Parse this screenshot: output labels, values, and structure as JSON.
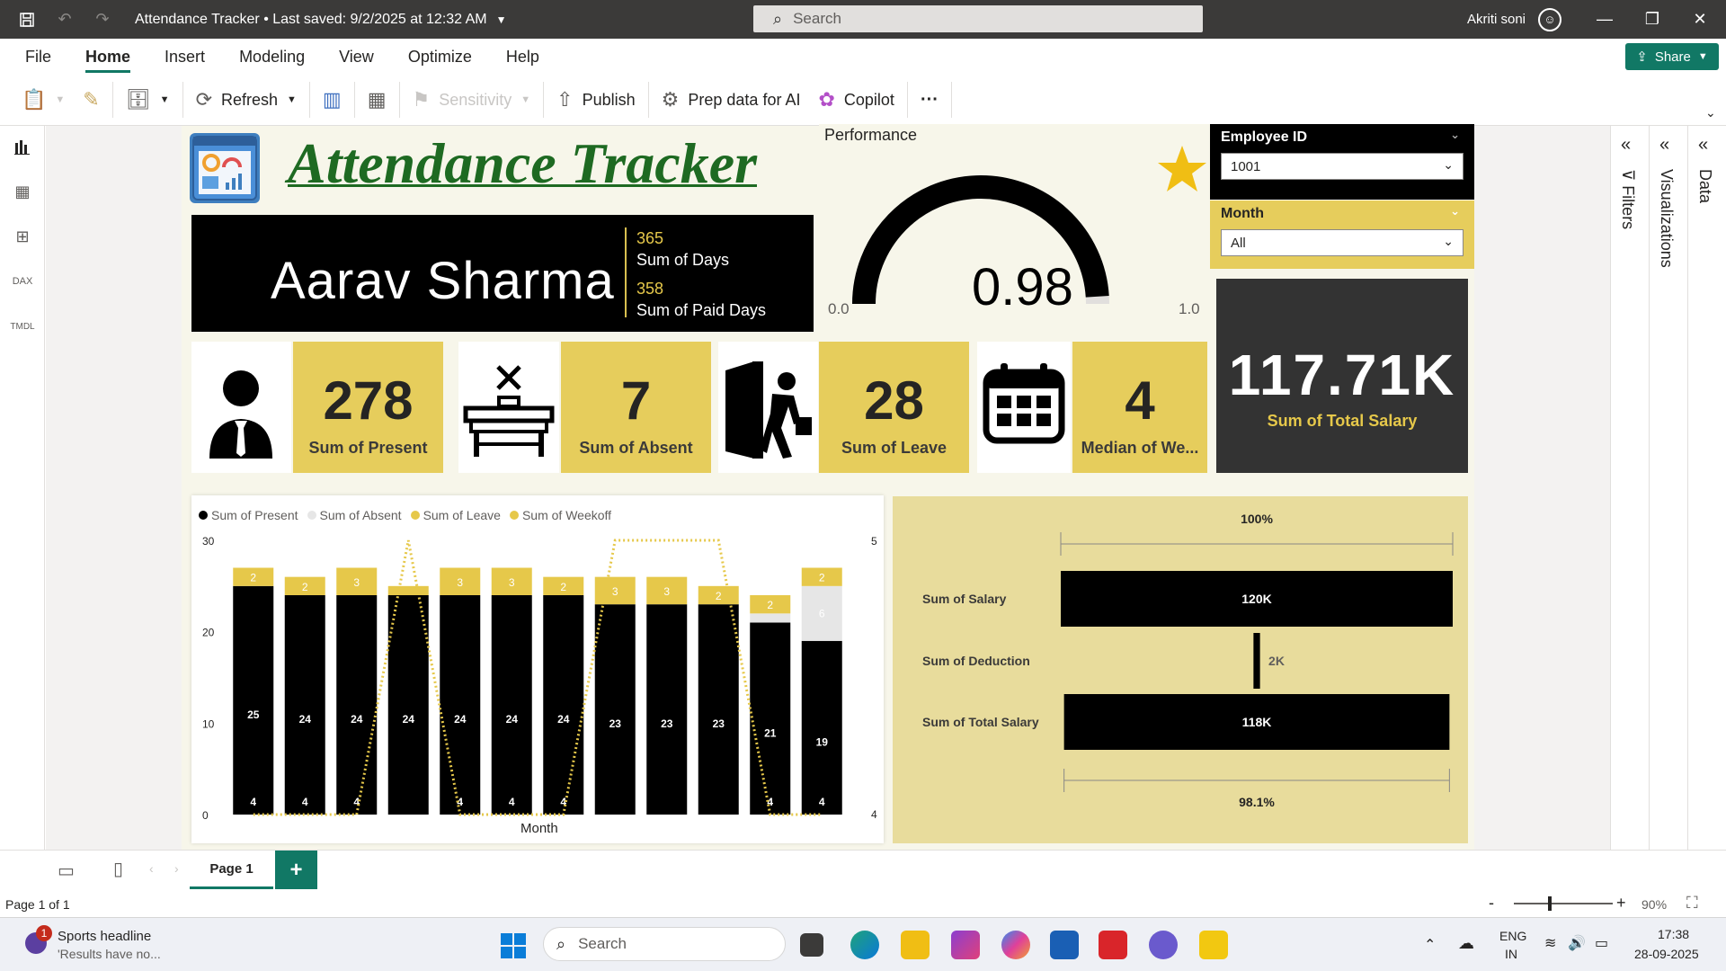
{
  "titlebar": {
    "title": "Attendance Tracker • Last saved: 9/2/2025 at 12:32 AM",
    "search_placeholder": "Search",
    "user_name": "Akriti soni"
  },
  "menu": {
    "items": [
      "File",
      "Home",
      "Insert",
      "Modeling",
      "View",
      "Optimize",
      "Help"
    ],
    "active": "Home",
    "share_label": "Share"
  },
  "ribbon": {
    "refresh": "Refresh",
    "sensitivity": "Sensitivity",
    "publish": "Publish",
    "prep_data": "Prep data for AI",
    "copilot": "Copilot",
    "more": "···"
  },
  "report": {
    "title": "Attendance Tracker",
    "employee_name": "Aarav Sharma",
    "days_value": "365",
    "days_label": "Sum of Days",
    "paid_days_value": "358",
    "paid_days_label": "Sum of Paid Days",
    "performance_title": "Performance",
    "gauge_value": "0.98",
    "gauge_min": "0.0",
    "gauge_max": "1.0",
    "gauge_fraction": 0.98,
    "slicer_employee_label": "Employee ID",
    "slicer_employee_value": "1001",
    "slicer_month_label": "Month",
    "slicer_month_value": "All",
    "total_salary_value": "117.71K",
    "total_salary_label": "Sum of Total Salary",
    "kpis": [
      {
        "value": "278",
        "label": "Sum of Present"
      },
      {
        "value": "7",
        "label": "Sum of Absent"
      },
      {
        "value": "28",
        "label": "Sum of Leave"
      },
      {
        "value": "4",
        "label": "Median of We..."
      }
    ]
  },
  "chart_data": [
    {
      "type": "bar",
      "stacked": true,
      "xlabel": "Month",
      "ylabel": "",
      "ylim": [
        0,
        30
      ],
      "y2lim": [
        4,
        5
      ],
      "yticks": [
        "30",
        "20",
        "10",
        "0"
      ],
      "y2ticks": [
        "5",
        "4"
      ],
      "legend": [
        "Sum of Present",
        "Sum of Absent",
        "Sum of Leave",
        "Sum of Weekoff"
      ],
      "legend_position": "top-left",
      "colors": {
        "present": "#000000",
        "absent": "#e6e6e6",
        "leave": "#e6c84a",
        "weekoff": "#e6c84a"
      },
      "series": [
        {
          "name": "Sum of Present",
          "values": [
            25,
            24,
            24,
            24,
            24,
            24,
            24,
            23,
            23,
            23,
            21,
            19
          ]
        },
        {
          "name": "Sum of Absent",
          "values": [
            0,
            0,
            0,
            0,
            0,
            0,
            0,
            0,
            0,
            0,
            1,
            6
          ]
        },
        {
          "name": "Sum of Leave",
          "values": [
            2,
            2,
            3,
            1,
            3,
            3,
            2,
            3,
            3,
            2,
            2,
            2
          ]
        },
        {
          "name": "Sum of Weekoff",
          "values": [
            4,
            4,
            4,
            5,
            4,
            4,
            4,
            5,
            5,
            5,
            4,
            4
          ]
        }
      ],
      "bar_labels_present": [
        "25",
        "24",
        "24",
        "24",
        "24",
        "24",
        "24",
        "23",
        "23",
        "23",
        "21",
        "19"
      ],
      "bar_labels_leave": [
        "2",
        "2",
        "3",
        "",
        "3",
        "3",
        "2",
        "3",
        "3",
        "2",
        "2",
        "2"
      ],
      "bar_labels_absent": [
        "",
        "",
        "",
        "",
        "",
        "",
        "",
        "",
        "",
        "",
        "",
        "6"
      ],
      "weekoff_labels": [
        "4",
        "4",
        "4",
        "",
        "4",
        "4",
        "4",
        "",
        "",
        "",
        "4",
        "4"
      ]
    },
    {
      "type": "bar",
      "orientation": "funnel",
      "categories": [
        "Sum of Salary",
        "Sum of Deduction",
        "Sum of Total Salary"
      ],
      "values": [
        120,
        2,
        118
      ],
      "value_labels": [
        "120K",
        "2K",
        "118K"
      ],
      "top_label": "100%",
      "bottom_label": "98.1%"
    }
  ],
  "pages": {
    "tab": "Page 1",
    "add": "+"
  },
  "status": {
    "page_info": "Page 1 of 1",
    "zoom": "90%",
    "zoom_minus": "-",
    "zoom_plus": "+"
  },
  "panes": {
    "filters": "Filters",
    "visualizations": "Visualizations",
    "data": "Data"
  },
  "taskbar": {
    "news_title": "Sports headline",
    "news_sub": "'Results have no...",
    "news_badge": "1",
    "search": "Search",
    "lang1": "ENG",
    "lang2": "IN",
    "time": "17:38",
    "date": "28-09-2025"
  }
}
